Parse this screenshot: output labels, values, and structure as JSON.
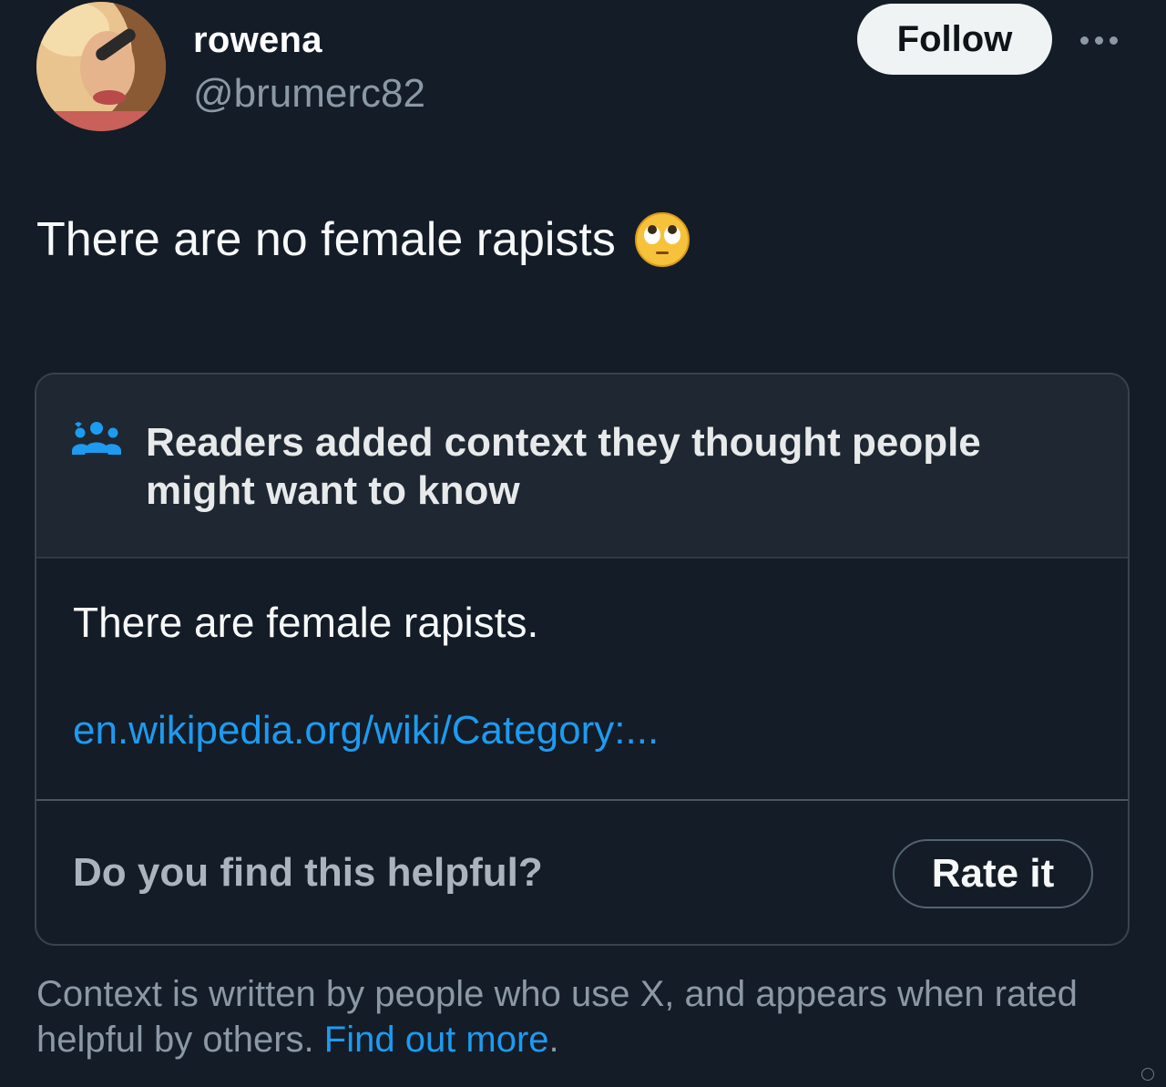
{
  "author": {
    "display_name": "rowena",
    "handle": "@brumerc82",
    "follow_label": "Follow"
  },
  "tweet": {
    "text": "There are no female rapists",
    "emoji": "face-with-rolling-eyes-emoji"
  },
  "community_note": {
    "title": "Readers added context they thought people might want to know",
    "body": "There are female rapists.",
    "link": "en.wikipedia.org/wiki/Category:...",
    "question": "Do you find this helpful?",
    "rate_label": "Rate it"
  },
  "footer": {
    "text": "Context is written by people who use X, and appears when rated helpful by others.",
    "link": "Find out more",
    "end": "."
  },
  "colors": {
    "background": "#141c27",
    "link": "#1d9bf0",
    "muted": "#8b98a5"
  }
}
